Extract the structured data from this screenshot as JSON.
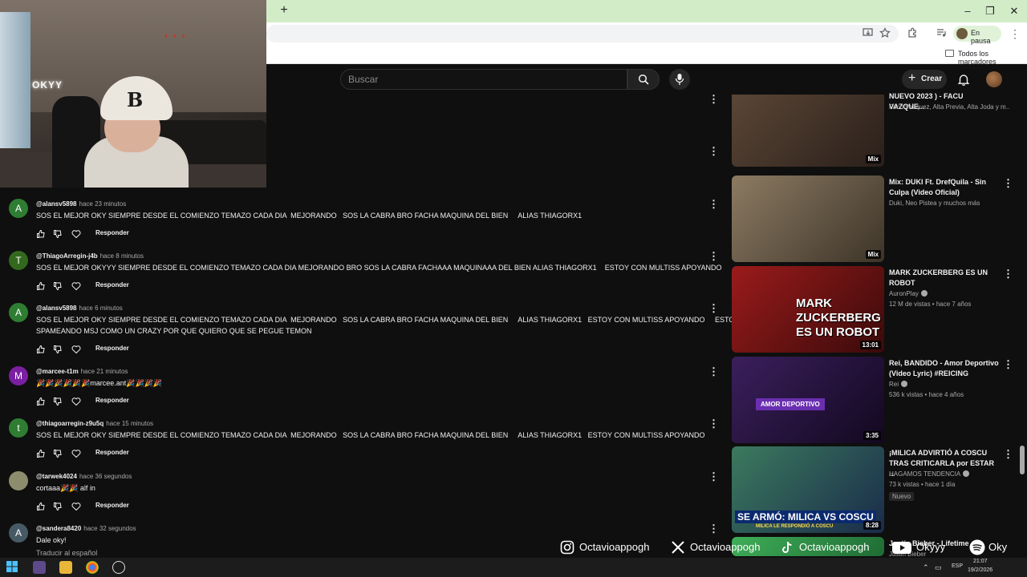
{
  "browser": {
    "new_tab": "+",
    "profile_status": "En pausa",
    "bookmarks_folder": "Todos los marcadores",
    "window_controls": [
      "–",
      "❐",
      "✕"
    ]
  },
  "header": {
    "search_placeholder": "Buscar",
    "create_label": "Crear"
  },
  "webcam": {
    "neon_sign": "OKYY",
    "cap_logo": "B"
  },
  "comments": [
    {
      "avatar_letter": "A",
      "avatar_color": "#2e7d32",
      "handle": "@alansv5898",
      "time": "hace 23 minutos",
      "lines": [
        "SOS EL MEJOR OKY SIEMPRE DESDE EL COMIENZO TEMAZO CADA DIA  MEJORANDO   SOS LA CABRA BRO FACHA MAQUINA DEL BIEN     ALIAS THIAGORX1"
      ],
      "reply": "Responder"
    },
    {
      "avatar_letter": "T",
      "avatar_color": "#33691e",
      "handle": "@ThiagoArregin-j4b",
      "time": "hace 8 minutos",
      "lines": [
        "SOS EL MEJOR OKYYY SIEMPRE DESDE EL COMIENZO TEMAZO CADA DIA MEJORANDO BRO SOS LA CABRA FACHAAA MAQUINAAA DEL BIEN ALIAS THIAGORX1    ESTOY CON MULTISS APOYANDO"
      ],
      "reply": "Responder"
    },
    {
      "avatar_letter": "A",
      "avatar_color": "#2e7d32",
      "handle": "@alansv5898",
      "time": "hace 6 minutos",
      "lines": [
        "SOS EL MEJOR OKY SIEMPRE DESDE EL COMIENZO TEMAZO CADA DIA  MEJORANDO   SOS LA CABRA BRO FACHA MAQUINA DEL BIEN     ALIAS THIAGORX1   ESTOY CON MULTISS APOYANDO     ESTOY",
        "SPAMEANDO MSJ COMO UN CRAZY POR QUE QUIERO QUE SE PEGUE TEMON"
      ],
      "reply": "Responder"
    },
    {
      "avatar_letter": "M",
      "avatar_color": "#7b1fa2",
      "handle": "@marcee-t1m",
      "time": "hace 21 minutos",
      "lines": [
        "🎉🎉🎉🎉🎉🎉marcee.ant🎉🎉🎉🎉"
      ],
      "reply": "Responder"
    },
    {
      "avatar_letter": "t",
      "avatar_color": "#2e7d32",
      "handle": "@thiagoarregin-z9u5q",
      "time": "hace 15 minutos",
      "lines": [
        "SOS EL MEJOR OKY SIEMPRE DESDE EL COMIENZO TEMAZO CADA DIA  MEJORANDO   SOS LA CABRA BRO FACHA MAQUINA DEL BIEN     ALIAS THIAGORX1   ESTOY CON MULTISS APOYANDO"
      ],
      "reply": "Responder"
    },
    {
      "avatar_letter": "",
      "avatar_color": "#8d8d6e",
      "handle": "@tarwek4024",
      "time": "hace 36 segundos",
      "lines": [
        "cortaaa🎉🎉 alf in"
      ],
      "reply": "Responder"
    },
    {
      "avatar_letter": "A",
      "avatar_color": "#455a64",
      "handle": "@sandera8420",
      "time": "hace 32 segundos",
      "lines": [
        "Dale oky!"
      ],
      "reply": "",
      "translate": "Traducir al español"
    }
  ],
  "sidebar_videos": [
    {
      "title": "NUEVO 2023 ) - FACU VAZQUE...",
      "channel": "Facu Vazquez, Alta Previa, Alta Joda y m...",
      "meta": "",
      "badge": "Mix",
      "thumb": [
        "#5a4636",
        "#2a1f1a"
      ]
    },
    {
      "title": "Mix: DUKI Ft. DrefQuila - Sin Culpa (Video Oficial)",
      "channel": "Duki, Neo Pistea y muchos más",
      "meta": "",
      "badge": "Mix",
      "thumb": [
        "#8c7b63",
        "#3d3428"
      ]
    },
    {
      "title": "MARK ZUCKERBERG ES UN ROBOT",
      "channel": "AuronPlay",
      "meta": "12 M de vistas • hace 7 años",
      "badge": "13:01",
      "thumb_text": "MARK ZUCKERBERG ES UN ROBOT",
      "thumb": [
        "#9b1b1b",
        "#3a0a0a"
      ]
    },
    {
      "title": "Rei, BANDIDO - Amor Deportivo (Video Lyric) #REICING",
      "channel": "Rei",
      "meta": "536 k vistas • hace 4 años",
      "badge": "3:35",
      "thumb_text": "AMOR DEPORTIVO",
      "thumb": [
        "#3b1f5c",
        "#12081f"
      ]
    },
    {
      "title": "¡MILICA ADVIRTIÓ A COSCU TRAS CRITICARLA por ESTAR ...",
      "channel": "HAGAMOS TENDENCIA",
      "meta": "73 k vistas • hace 1 día",
      "new_badge": "Nuevo",
      "badge": "8:28",
      "thumb_text": "SE ARMÓ: MILICA VS COSCU",
      "thumb_sub": "MILICA LE RESPONDIÓ A COSCU",
      "thumb": [
        "#3b7a5e",
        "#1a2b4a"
      ]
    },
    {
      "title": "Justin Bieber - Lifetime",
      "channel": "Justin Bieber",
      "meta": "",
      "badge": "",
      "thumb": [
        "#3fae58",
        "#1f6b34"
      ]
    }
  ],
  "social": [
    {
      "icon": "instagram-icon",
      "handle": "Octavioappogh"
    },
    {
      "icon": "x-icon",
      "handle": "Octavioappogh"
    },
    {
      "icon": "tiktok-icon",
      "handle": "Octavioappogh"
    },
    {
      "icon": "youtube-icon",
      "handle": "Okyyy"
    },
    {
      "icon": "spotify-icon",
      "handle": "Oky"
    }
  ],
  "taskbar": {
    "language": "ESP",
    "time": "21:07",
    "date": "19/2/2026"
  }
}
